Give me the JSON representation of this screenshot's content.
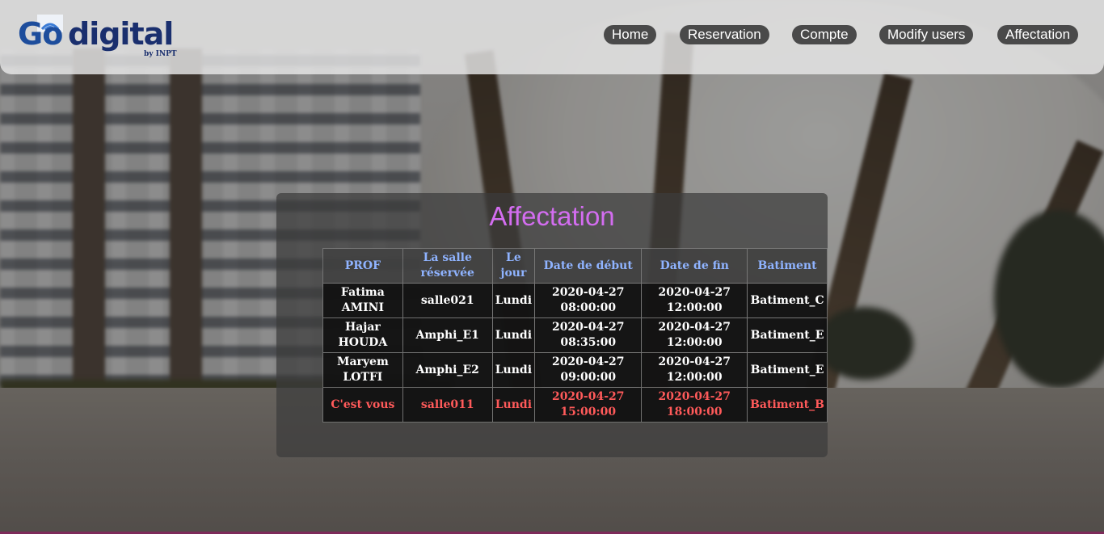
{
  "logo": {
    "go": "Go",
    "digital": "digital",
    "sub": "by INPT"
  },
  "nav": {
    "items": [
      "Home",
      "Reservation",
      "Compte",
      "Modify users",
      "Affectation"
    ]
  },
  "main": {
    "title": "Affectation",
    "columns": [
      "PROF",
      "La salle réservée",
      "Le jour",
      "Date de début",
      "Date de fin",
      "Batiment"
    ],
    "rows": [
      [
        "Fatima AMINI",
        "salle021",
        "Lundi",
        "2020-04-27 08:00:00",
        "2020-04-27 12:00:00",
        "Batiment_C"
      ],
      [
        "Hajar HOUDA",
        "Amphi_E1",
        "Lundi",
        "2020-04-27 08:35:00",
        "2020-04-27 12:00:00",
        "Batiment_E"
      ],
      [
        "Maryem LOTFI",
        "Amphi_E2",
        "Lundi",
        "2020-04-27 09:00:00",
        "2020-04-27 12:00:00",
        "Batiment_E"
      ],
      [
        "C'est vous",
        "salle011",
        "Lundi",
        "2020-04-27 15:00:00",
        "2020-04-27 18:00:00",
        "Batiment_B"
      ]
    ],
    "highlight_row_color": "#ff5a5a",
    "header_text_color": "#8fb3ff",
    "title_color": "#d36df0"
  }
}
